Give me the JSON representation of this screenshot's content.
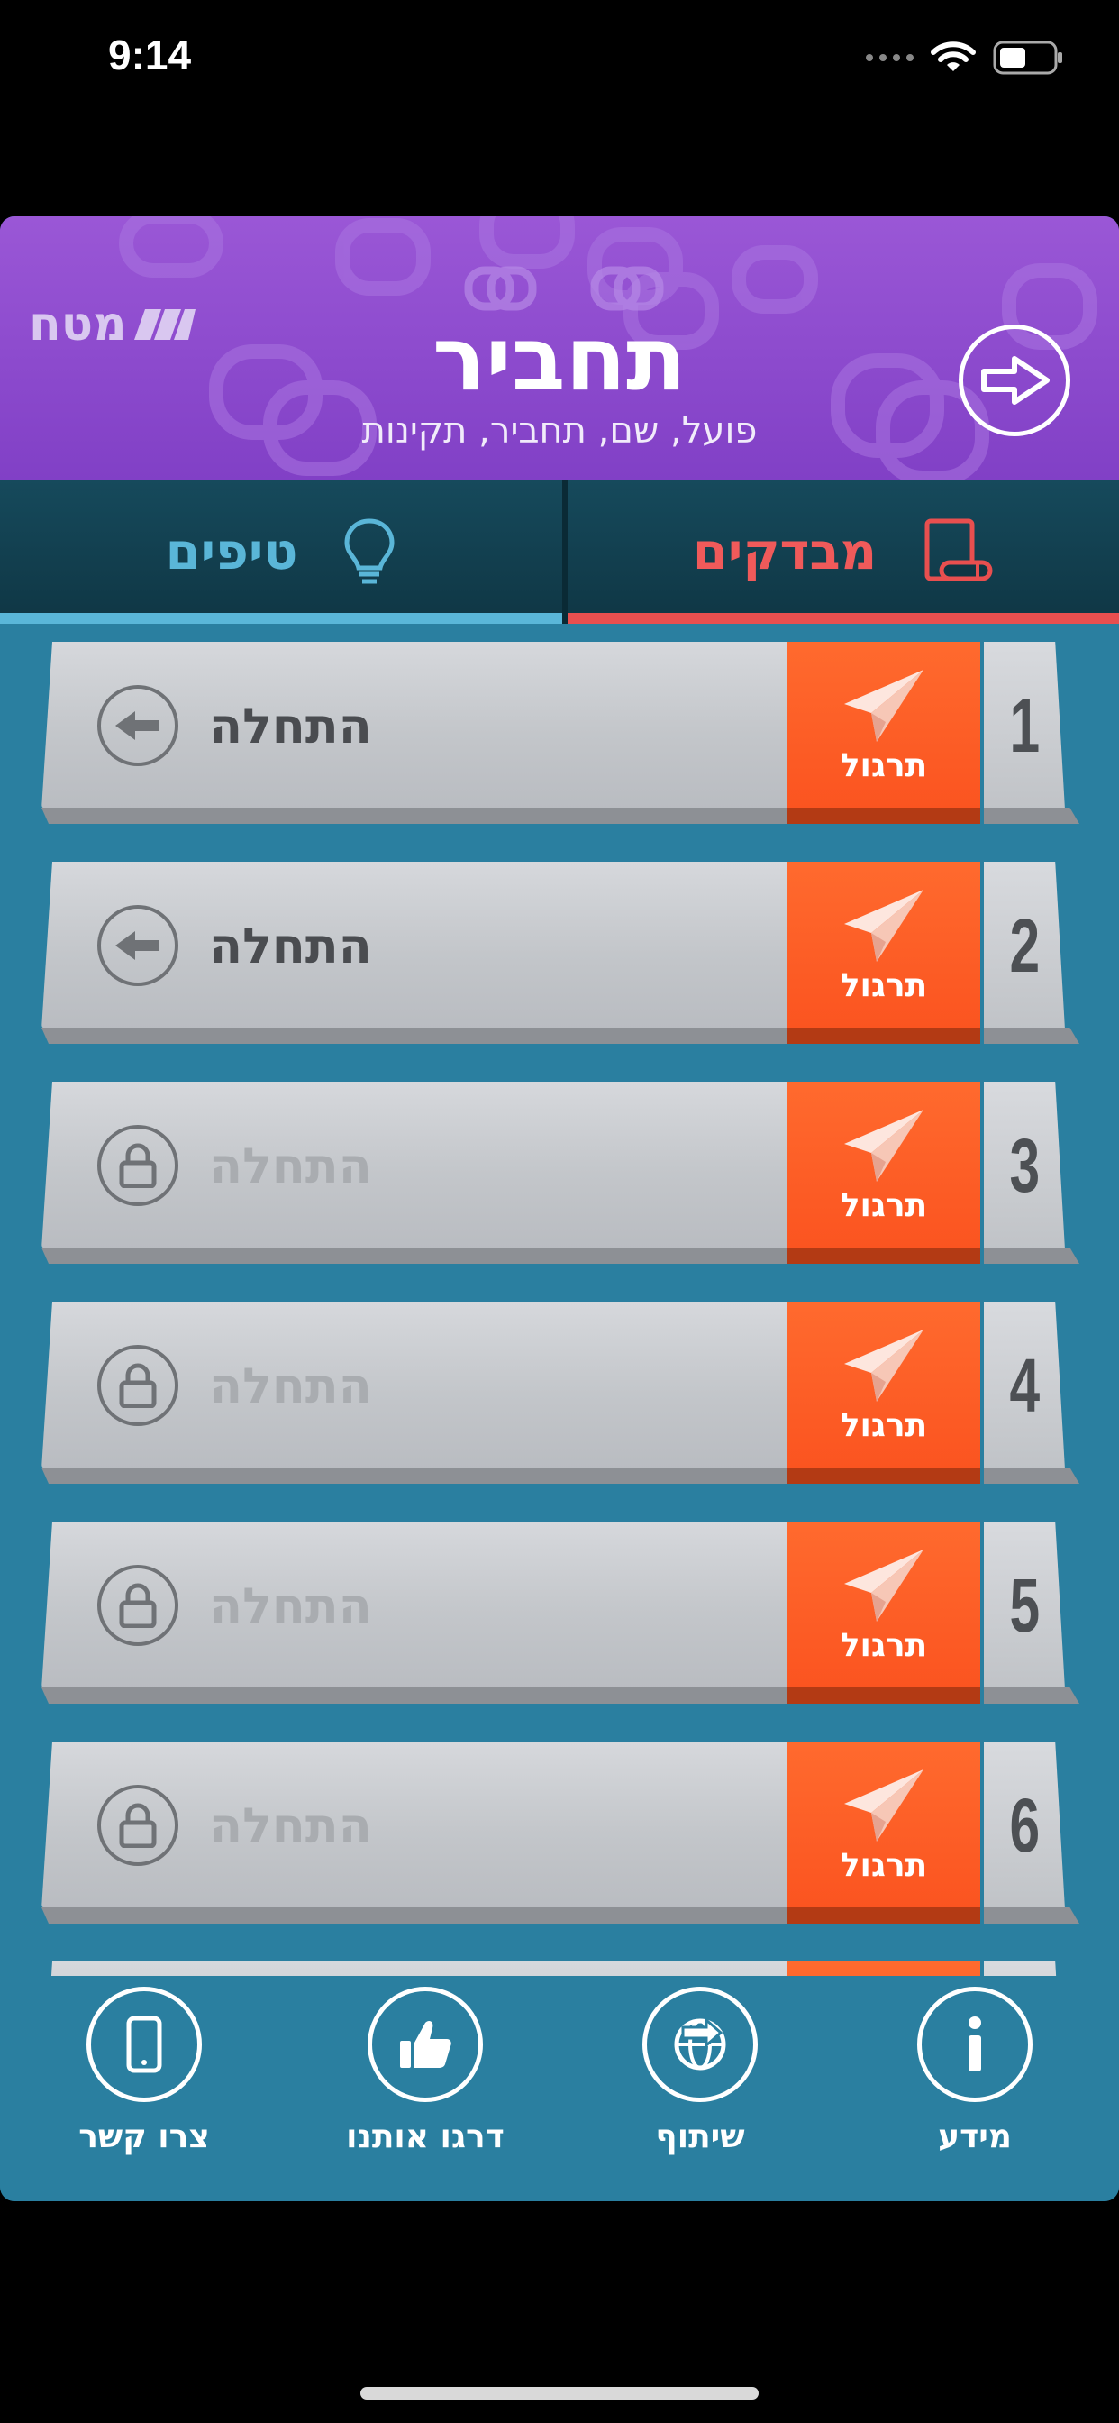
{
  "status": {
    "time": "9:14"
  },
  "header": {
    "brand": "מטח",
    "title": "תחביר",
    "subtitle": "פועל, שם, תחביר, תקינות"
  },
  "tabs": {
    "tests": "מבדקים",
    "tips": "טיפים"
  },
  "levels": [
    {
      "number": "1",
      "start": "התחלה",
      "practice": "תרגול",
      "locked": false
    },
    {
      "number": "2",
      "start": "התחלה",
      "practice": "תרגול",
      "locked": false
    },
    {
      "number": "3",
      "start": "התחלה",
      "practice": "תרגול",
      "locked": true
    },
    {
      "number": "4",
      "start": "התחלה",
      "practice": "תרגול",
      "locked": true
    },
    {
      "number": "5",
      "start": "התחלה",
      "practice": "תרגול",
      "locked": true
    },
    {
      "number": "6",
      "start": "התחלה",
      "practice": "תרגול",
      "locked": true
    }
  ],
  "nav": {
    "contact": "צרו קשר",
    "rate": "דרגו אותנו",
    "share": "שיתוף",
    "info": "מידע"
  },
  "colors": {
    "header": "#8d4acd",
    "practice": "#fb5420",
    "background": "#2a7fa0",
    "tests_accent": "#e84f4f",
    "tips_accent": "#5ab6d8"
  }
}
